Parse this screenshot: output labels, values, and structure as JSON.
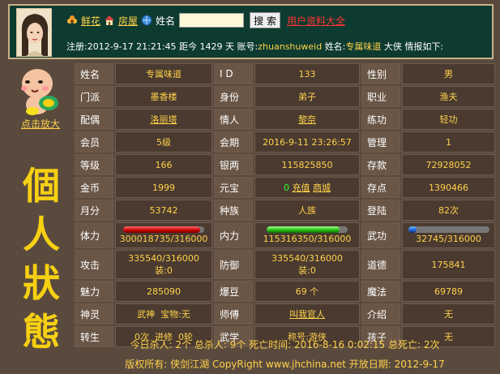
{
  "header": {
    "links": [
      "鲜花",
      "房屋"
    ],
    "name_label": "姓名",
    "search_button": "搜 索",
    "user_all_link": "用户资料大全",
    "info_line": {
      "reg_label": "注册:",
      "reg_time": "2012-9-17 21:21:45",
      "days_label": "距今",
      "days_value": "1429",
      "days_unit": "天",
      "account_label": "账号:",
      "account": "zhuanshuweid",
      "name_label": "姓名:",
      "name": "专属味道",
      "title": "大侠",
      "suffix": "情报如下:"
    }
  },
  "left": {
    "enlarge_link": "点击放大",
    "status_chars": [
      "個",
      "人",
      "狀",
      "態"
    ]
  },
  "stats": {
    "name_label": "姓名",
    "name": "专属味道",
    "id_label": "I D",
    "id": "133",
    "gender_label": "性别",
    "gender": "男",
    "sect_label": "门派",
    "sect": "墨香楼",
    "identity_label": "身份",
    "identity": "弟子",
    "job_label": "职业",
    "job": "渔夫",
    "spouse_label": "配偶",
    "spouse": "洛丽塔",
    "lover_label": "情人",
    "lover": "黎奈",
    "practice_label": "练功",
    "practice": "轻功",
    "member_label": "会员",
    "member": "5级",
    "expire_label": "会期",
    "expire": "2016-9-11 23:26:57",
    "manage_label": "管理",
    "manage": "1",
    "level_label": "等级",
    "level": "166",
    "silver_label": "银两",
    "silver": "115825850",
    "deposit_label": "存款",
    "deposit": "72928052",
    "gold_label": "金币",
    "gold": "1999",
    "yuanbao_label": "元宝",
    "yuanbao": "0",
    "recharge_link": "充值",
    "shop_link": "商城",
    "points_label": "存点",
    "points": "1390466",
    "month_label": "月分",
    "month": "53742",
    "race_label": "种族",
    "race": "人族",
    "login_label": "登陆",
    "login": "82次",
    "hp_label": "体力",
    "hp_text": "300018735/316000",
    "hp_fraction": 0.95,
    "mp_label": "内力",
    "mp_text": "115316350/316000",
    "mp_fraction": 0.9,
    "wu_label": "武功",
    "wu_text": "32745/316000",
    "wu_fraction": 0.104,
    "attack_label": "攻击",
    "attack": "335540/316000",
    "attack_equip": "装:0",
    "defense_label": "防御",
    "defense": "335540/316000",
    "defense_equip": "装:0",
    "morality_label": "道德",
    "morality": "175841",
    "charm_label": "魅力",
    "charm": "285090",
    "bean_label": "爆豆",
    "bean": "69 个",
    "magic_label": "魔法",
    "magic": "69789",
    "spirit_label": "神灵",
    "spirit": "武神",
    "treasure": "宝物:无",
    "master_label": "师傅",
    "master": "叫我官人",
    "intro_label": "介绍",
    "intro": "无",
    "rebirth_label": "转生",
    "rebirth": "0次",
    "advance": "进修",
    "wheel": "0轮",
    "school_label": "武学",
    "school": "称号:游侠",
    "child_label": "孩子",
    "child": "无"
  },
  "footer": {
    "kills_line": "今日杀人: 2个     总杀人: 9个     死亡时间: 2016-8-16 0:02:15     总死亡: 2次",
    "copyright_line": "版权所有: 侠剑江湖 CopyRight www.jhchina.net   开放日期: 2012-9-17"
  },
  "colors": {
    "background": "#5a4a3e",
    "header_bg": "#0e3b30",
    "value_yellow": "#ffd24a",
    "status_gold": "#f6d012"
  }
}
